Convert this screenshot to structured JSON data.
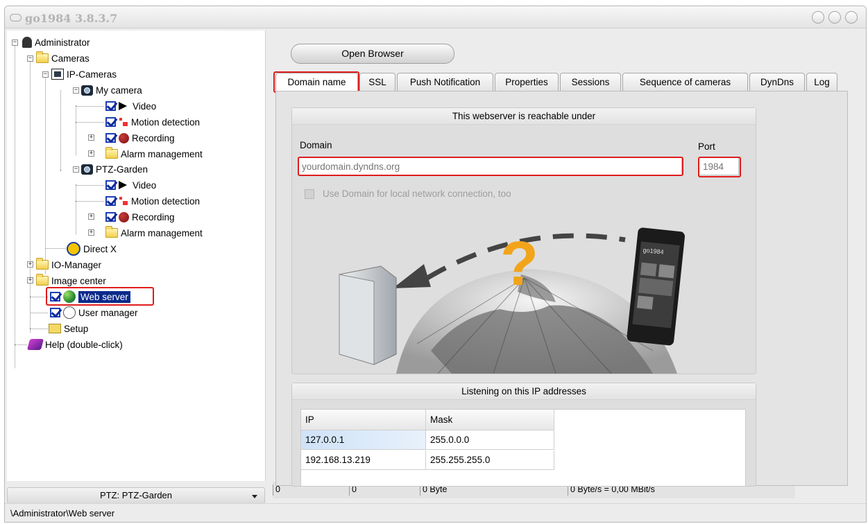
{
  "window": {
    "title": "go1984 3.8.3.7"
  },
  "tree": {
    "administrator": "Administrator",
    "cameras": "Cameras",
    "ip_cameras": "IP-Cameras",
    "my_camera": "My camera",
    "my_camera_children": [
      "Video",
      "Motion detection",
      "Recording",
      "Alarm management"
    ],
    "ptz_garden": "PTZ-Garden",
    "ptz_children": [
      "Video",
      "Motion detection",
      "Recording",
      "Alarm management"
    ],
    "direct_x": "Direct X",
    "io_manager": "IO-Manager",
    "image_center": "Image center",
    "web_server": "Web server",
    "user_manager": "User manager",
    "setup": "Setup",
    "help": "Help (double-click)",
    "expander_plus": "+",
    "expander_minus": "−"
  },
  "camera_select": {
    "value": "PTZ: PTZ-Garden"
  },
  "status": {
    "c1": "0",
    "c2": "0",
    "bytes": "0 Byte",
    "rate": "0 Byte/s = 0,00 MBit/s"
  },
  "path": "\\Administrator\\Web server",
  "open_browser_label": "Open Browser",
  "tabs": [
    "Domain name",
    "SSL",
    "Push Notification",
    "Properties",
    "Sessions",
    "Sequence of cameras",
    "DynDns",
    "Log"
  ],
  "domain_group": {
    "title": "This webserver is reachable under",
    "domain_label": "Domain",
    "port_label": "Port",
    "domain_placeholder": "yourdomain.dyndns.org",
    "port_placeholder": "1984",
    "use_domain_label": "Use Domain for local network connection, too"
  },
  "illustration": {
    "phone_label": "go1984"
  },
  "ip_group": {
    "title": "Listening on this IP addresses",
    "columns": [
      "IP",
      "Mask"
    ],
    "rows": [
      {
        "ip": "127.0.0.1",
        "mask": "255.0.0.0"
      },
      {
        "ip": "192.168.13.219",
        "mask": "255.255.255.0"
      }
    ]
  },
  "colors": {
    "highlight": "#e01c1c",
    "selection": "#0a2a8c",
    "check": "#1e3fb5"
  }
}
